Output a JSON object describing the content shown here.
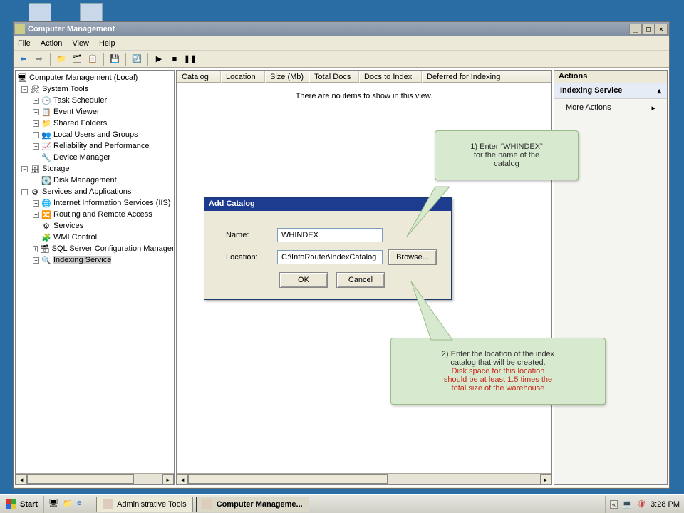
{
  "window": {
    "title": "Computer Management",
    "menus": [
      "File",
      "Action",
      "View",
      "Help"
    ],
    "titlebar_buttons": {
      "min": "_",
      "max": "□",
      "close": "✕"
    }
  },
  "tree": {
    "root": "Computer Management (Local)",
    "system_tools": {
      "label": "System Tools",
      "children": [
        "Task Scheduler",
        "Event Viewer",
        "Shared Folders",
        "Local Users and Groups",
        "Reliability and Performance",
        "Device Manager"
      ]
    },
    "storage": {
      "label": "Storage",
      "children": [
        "Disk Management"
      ]
    },
    "services_apps": {
      "label": "Services and Applications",
      "children": [
        "Internet Information Services (IIS)",
        "Routing and Remote Access",
        "Services",
        "WMI Control",
        "SQL Server Configuration Manager",
        "Indexing Service"
      ]
    }
  },
  "list": {
    "columns": [
      "Catalog",
      "Location",
      "Size (Mb)",
      "Total Docs",
      "Docs to Index",
      "Deferred for Indexing"
    ],
    "empty_msg": "There are no items to show in this view."
  },
  "actions": {
    "header": "Actions",
    "section": "Indexing Service",
    "item": "More Actions"
  },
  "dialog": {
    "title": "Add Catalog",
    "name_label": "Name:",
    "name_value": "WHINDEX",
    "location_label": "Location:",
    "location_value": "C:\\InfoRouter\\IndexCatalog",
    "browse": "Browse...",
    "ok": "OK",
    "cancel": "Cancel"
  },
  "callouts": {
    "c1_line1": "1) Enter “WHINDEX”",
    "c1_line2": "for the name of the",
    "c1_line3": "catalog",
    "c2_line1": "2) Enter the location of the index",
    "c2_line2": "catalog that will be created.",
    "c2_line3": "Disk space for this location",
    "c2_line4": "should be at least 1.5 times the",
    "c2_line5": "total size of the warehouse"
  },
  "taskbar": {
    "start": "Start",
    "tasks": [
      "Administrative Tools",
      "Computer Manageme..."
    ],
    "chev": "«",
    "clock": "3:28 PM"
  }
}
